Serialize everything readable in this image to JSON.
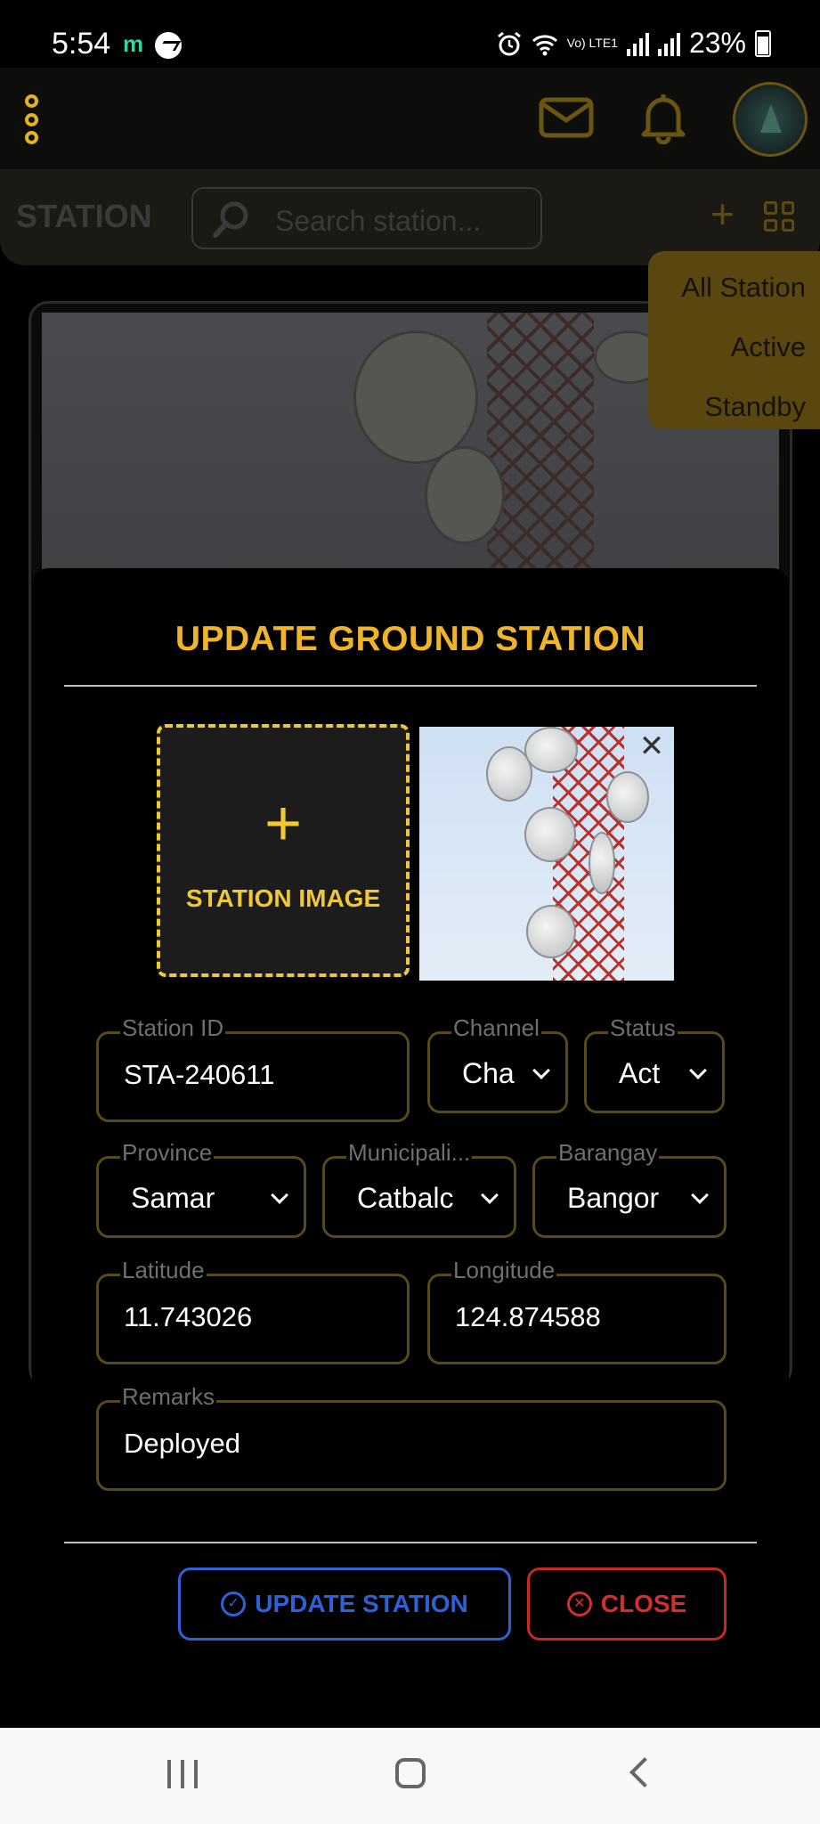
{
  "status_bar": {
    "time": "5:54",
    "app_letter": "m",
    "lte": "Vo) LTE1",
    "battery": "23%"
  },
  "header": {
    "icons": [
      "menu-dots-icon",
      "mail-icon",
      "bell-icon",
      "avatar"
    ]
  },
  "toolbar": {
    "title": "STATION",
    "search_placeholder": "Search station..."
  },
  "filter_menu": {
    "items": [
      "All Station",
      "Active",
      "Standby"
    ]
  },
  "modal": {
    "title": "UPDATE GROUND STATION",
    "image_upload_plus": "+",
    "image_upload_label": "STATION IMAGE",
    "fields": {
      "station_id": {
        "label": "Station ID",
        "value": "STA-240611"
      },
      "channel": {
        "label": "Channel",
        "value": "Cha"
      },
      "status": {
        "label": "Status",
        "value": "Act"
      },
      "province": {
        "label": "Province",
        "value": "Samar"
      },
      "municipality": {
        "label": "Municipali...",
        "value": "Catbalc"
      },
      "barangay": {
        "label": "Barangay",
        "value": "Bangor"
      },
      "latitude": {
        "label": "Latitude",
        "value": "11.743026"
      },
      "longitude": {
        "label": "Longitude",
        "value": "124.874588"
      },
      "remarks": {
        "label": "Remarks",
        "value": "Deployed"
      }
    },
    "update_button": "UPDATE STATION",
    "close_button": "CLOSE"
  },
  "colors": {
    "accent": "#f0b428",
    "field_border": "#57491a",
    "update_blue": "#2d62d6",
    "close_red": "#d32f2f"
  }
}
